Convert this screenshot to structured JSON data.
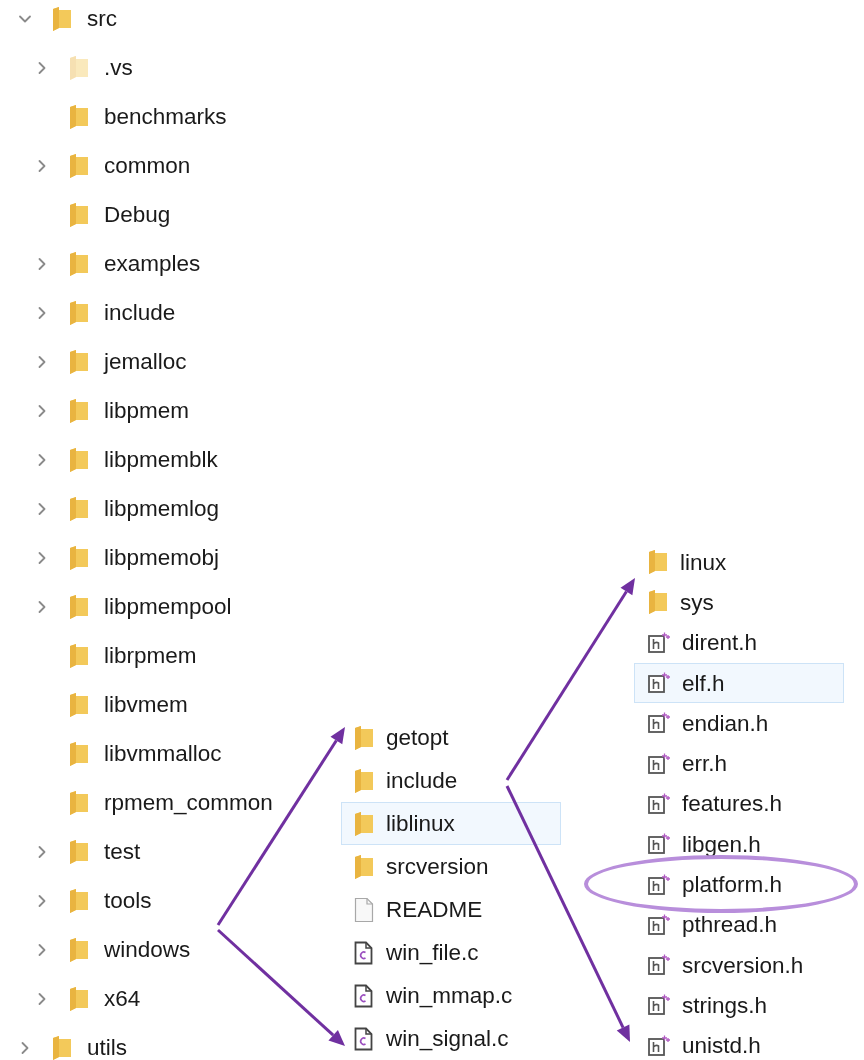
{
  "explorer_tree": {
    "items": [
      {
        "name": "src",
        "kind": "expanded",
        "hidden": false,
        "children": [
          {
            "name": ".vs",
            "kind": "collapsed",
            "hidden": true
          },
          {
            "name": "benchmarks",
            "kind": "leaf",
            "hidden": false
          },
          {
            "name": "common",
            "kind": "collapsed",
            "hidden": false
          },
          {
            "name": "Debug",
            "kind": "leaf",
            "hidden": false
          },
          {
            "name": "examples",
            "kind": "collapsed",
            "hidden": false
          },
          {
            "name": "include",
            "kind": "collapsed",
            "hidden": false
          },
          {
            "name": "jemalloc",
            "kind": "collapsed",
            "hidden": false
          },
          {
            "name": "libpmem",
            "kind": "collapsed",
            "hidden": false
          },
          {
            "name": "libpmemblk",
            "kind": "collapsed",
            "hidden": false
          },
          {
            "name": "libpmemlog",
            "kind": "collapsed",
            "hidden": false
          },
          {
            "name": "libpmemobj",
            "kind": "collapsed",
            "hidden": false
          },
          {
            "name": "libpmempool",
            "kind": "collapsed",
            "hidden": false
          },
          {
            "name": "librpmem",
            "kind": "leaf",
            "hidden": false
          },
          {
            "name": "libvmem",
            "kind": "leaf",
            "hidden": false
          },
          {
            "name": "libvmmalloc",
            "kind": "leaf",
            "hidden": false
          },
          {
            "name": "rpmem_common",
            "kind": "leaf",
            "hidden": false
          },
          {
            "name": "test",
            "kind": "collapsed",
            "hidden": false
          },
          {
            "name": "tools",
            "kind": "collapsed",
            "hidden": false
          },
          {
            "name": "windows",
            "kind": "collapsed",
            "hidden": false
          },
          {
            "name": "x64",
            "kind": "collapsed",
            "hidden": false
          }
        ]
      },
      {
        "name": "utils",
        "kind": "collapsed",
        "hidden": false
      }
    ]
  },
  "windows_listing": {
    "items": [
      {
        "name": "getopt",
        "kind": "folder",
        "selected": false
      },
      {
        "name": "include",
        "kind": "folder",
        "selected": false
      },
      {
        "name": "liblinux",
        "kind": "folder",
        "selected": true
      },
      {
        "name": "srcversion",
        "kind": "folder",
        "selected": false
      },
      {
        "name": "README",
        "kind": "file",
        "selected": false
      },
      {
        "name": "win_file.c",
        "kind": "c",
        "selected": false
      },
      {
        "name": "win_mmap.c",
        "kind": "c",
        "selected": false
      },
      {
        "name": "win_signal.c",
        "kind": "c",
        "selected": false
      }
    ]
  },
  "liblinux_listing": {
    "items": [
      {
        "name": "linux",
        "kind": "folder",
        "selected": false,
        "circled": false
      },
      {
        "name": "sys",
        "kind": "folder",
        "selected": false,
        "circled": false
      },
      {
        "name": "dirent.h",
        "kind": "header",
        "selected": false,
        "circled": false
      },
      {
        "name": "elf.h",
        "kind": "header",
        "selected": true,
        "circled": false
      },
      {
        "name": "endian.h",
        "kind": "header",
        "selected": false,
        "circled": false
      },
      {
        "name": "err.h",
        "kind": "header",
        "selected": false,
        "circled": false
      },
      {
        "name": "features.h",
        "kind": "header",
        "selected": false,
        "circled": false
      },
      {
        "name": "libgen.h",
        "kind": "header",
        "selected": false,
        "circled": false
      },
      {
        "name": "platform.h",
        "kind": "header",
        "selected": false,
        "circled": true
      },
      {
        "name": "pthread.h",
        "kind": "header",
        "selected": false,
        "circled": false
      },
      {
        "name": "srcversion.h",
        "kind": "header",
        "selected": false,
        "circled": false
      },
      {
        "name": "strings.h",
        "kind": "header",
        "selected": false,
        "circled": false
      },
      {
        "name": "unistd.h",
        "kind": "header",
        "selected": false,
        "circled": false
      }
    ]
  },
  "annotations": [
    {
      "kind": "arrow"
    },
    {
      "kind": "arrow"
    },
    {
      "kind": "arrow"
    },
    {
      "kind": "arrow"
    }
  ]
}
